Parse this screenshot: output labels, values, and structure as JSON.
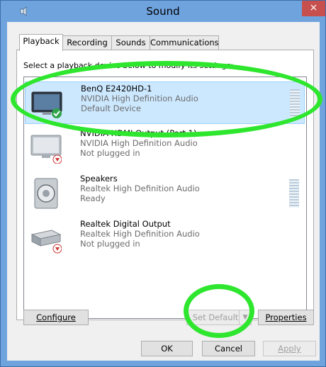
{
  "window": {
    "title": "Sound",
    "close_glyph": "×"
  },
  "tabs": [
    {
      "label": "Playback",
      "active": true
    },
    {
      "label": "Recording",
      "active": false
    },
    {
      "label": "Sounds",
      "active": false
    },
    {
      "label": "Communications",
      "active": false
    }
  ],
  "playback": {
    "instructions": "Select a playback device below to modify its settings:",
    "devices": [
      {
        "name": "BenQ E2420HD-1",
        "driver": "NVIDIA High Definition Audio",
        "status": "Default Device",
        "icon": "monitor-icon",
        "badge": "default-check-icon",
        "selected": true
      },
      {
        "name": "NVIDIA HDMI Output (Port 1)",
        "driver": "NVIDIA High Definition Audio",
        "status": "Not plugged in",
        "icon": "monitor-icon",
        "badge": "unplugged-icon",
        "selected": false
      },
      {
        "name": "Speakers",
        "driver": "Realtek High Definition Audio",
        "status": "Ready",
        "icon": "speaker-icon",
        "badge": "",
        "selected": false
      },
      {
        "name": "Realtek Digital Output",
        "driver": "Realtek High Definition Audio",
        "status": "Not plugged in",
        "icon": "digital-output-icon",
        "badge": "unplugged-icon",
        "selected": false
      }
    ]
  },
  "buttons": {
    "configure": "Configure",
    "set_default": "Set Default",
    "properties": "Properties",
    "ok": "OK",
    "cancel": "Cancel",
    "apply": "Apply"
  },
  "colors": {
    "titlebar": "#6fa3de",
    "close_button": "#c7504f",
    "selection": "#cce8ff",
    "annotation": "#2ee62e"
  }
}
